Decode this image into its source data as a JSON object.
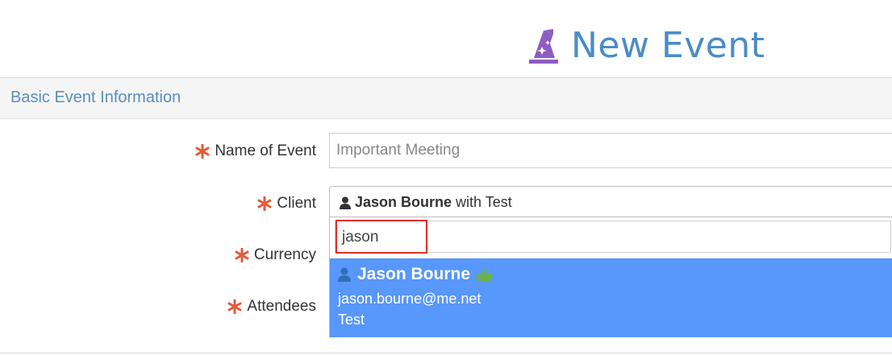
{
  "header": {
    "title": "New Event",
    "icon": "wizard-icon",
    "accent": "#4a8cc9",
    "icon_color": "#8e5bc2"
  },
  "section": {
    "title": "Basic Event Information"
  },
  "form": {
    "required_color": "#e05b3a",
    "name_of_event": {
      "label": "Name of Event",
      "placeholder": "Important Meeting"
    },
    "client": {
      "label": "Client",
      "selected_name": "Jason Bourne",
      "selected_suffix": "with Test"
    },
    "currency": {
      "label": "Currency"
    },
    "attendees": {
      "label": "Attendees"
    }
  },
  "client_dropdown": {
    "search_value": "jason",
    "highlight_color": "#5897fb",
    "option": {
      "name": "Jason Bourne",
      "email": "jason.bourne@me.net",
      "company": "Test",
      "badge_icon": "thumbs-up-icon"
    }
  }
}
